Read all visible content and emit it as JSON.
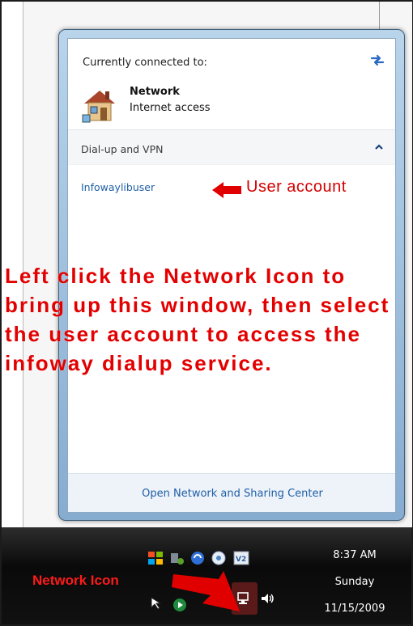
{
  "flyout": {
    "header_title": "Currently connected to:",
    "network_name": "Network",
    "network_status": "Internet access",
    "section_label": "Dial-up and VPN",
    "vpn_item": "Infowaylibuser",
    "footer_link": "Open Network and Sharing Center"
  },
  "annotations": {
    "user_account": "User account",
    "instructions": "Left click the Network Icon to bring up this window, then select the user account to access the infoway dialup service.",
    "network_icon_label": "Network Icon"
  },
  "clock": {
    "time": "8:37 AM",
    "day": "Sunday",
    "date": "11/15/2009"
  },
  "colors": {
    "annotation_red": "#e30000",
    "link_blue": "#1f5fa8"
  }
}
